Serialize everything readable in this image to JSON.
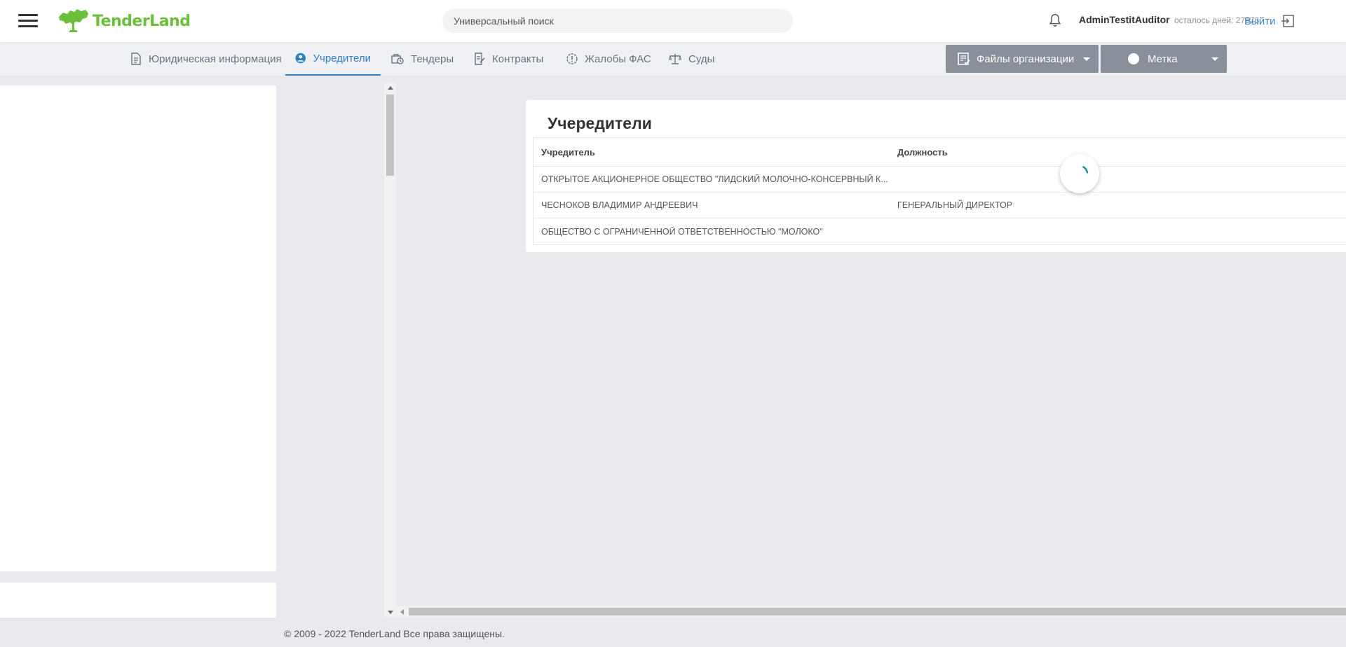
{
  "header": {
    "logo_text": "TenderLand",
    "search_placeholder": "Универсальный поиск",
    "username": "AdminTestitAuditor",
    "days_left": "осталось дней: 27876",
    "logout_label": "Выйти"
  },
  "tabs": [
    {
      "label": "Юридическая информация",
      "icon": "document-icon",
      "active": false
    },
    {
      "label": "Учредители",
      "icon": "user-circle-icon",
      "active": true
    },
    {
      "label": "Тендеры",
      "icon": "briefcase-clock-icon",
      "active": false
    },
    {
      "label": "Контракты",
      "icon": "contract-icon",
      "active": false
    },
    {
      "label": "Жалобы ФАС",
      "icon": "alert-circle-icon",
      "active": false
    },
    {
      "label": "Суды",
      "icon": "scales-icon",
      "active": false
    }
  ],
  "toolbar": {
    "files_label": "Файлы организации",
    "mark_label": "Метка"
  },
  "founders": {
    "title": "Учередители",
    "columns": [
      "Учредитель",
      "Должность"
    ],
    "rows": [
      {
        "name": "ОТКРЫТОЕ АКЦИОНЕРНОЕ ОБЩЕСТВО \"ЛИДСКИЙ МОЛОЧНО-КОНСЕРВНЫЙ К...",
        "position": ""
      },
      {
        "name": "ЧЕСНОКОВ ВЛАДИМИР АНДРЕЕВИЧ",
        "position": "ГЕНЕРАЛЬНЫЙ ДИРЕКТОР"
      },
      {
        "name": "ОБЩЕСТВО С ОГРАНИЧЕННОЙ ОТВЕТСТВЕННОСТЬЮ \"МОЛОКО\"",
        "position": ""
      }
    ]
  },
  "footer": {
    "copyright": "© 2009 - 2022 TenderLand Все права защищены."
  },
  "colors": {
    "accent": "#2f7fc4",
    "brand_green": "#6cbf3b",
    "button_gray": "#8a9099",
    "spinner": "#1a9a8a"
  }
}
